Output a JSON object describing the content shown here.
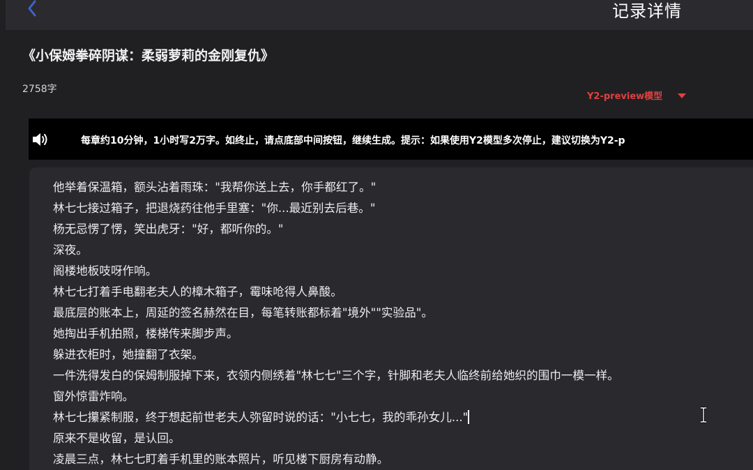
{
  "header": {
    "title": "记录详情",
    "back_icon": "chevron-left-icon"
  },
  "book": {
    "title": "《小保姆拳碎阴谋：柔弱萝莉的金刚复仇》",
    "word_count": "2758字"
  },
  "model_selector": {
    "selected": "Y2-preview模型",
    "icon": "caret-down-icon"
  },
  "notice": {
    "icon": "speaker-icon",
    "text": "每章约10分钟，1小时写2万字。如终止，请点底部中间按钮，继续生成。提示：如果使用Y2模型多次停止，建议切换为Y2-p"
  },
  "content": {
    "lines": [
      "他举着保温箱，额头沾着雨珠：\"我帮你送上去，你手都红了。\"",
      "林七七接过箱子，把退烧药往他手里塞：\"你...最近别去后巷。\"",
      "杨无忌愣了愣，笑出虎牙：\"好，都听你的。\"",
      "深夜。",
      "阁楼地板吱呀作响。",
      "林七七打着手电翻老夫人的樟木箱子，霉味呛得人鼻酸。",
      "最底层的账本上，周延的签名赫然在目，每笔转账都标着\"境外\"\"实验品\"。",
      "她掏出手机拍照，楼梯传来脚步声。",
      "躲进衣柜时，她撞翻了衣架。",
      "一件洗得发白的保姆制服掉下来，衣领内侧绣着\"林七七\"三个字，针脚和老夫人临终前给她织的围巾一模一样。",
      "窗外惊雷炸响。",
      "林七七攥紧制服，终于想起前世老夫人弥留时说的话：\"小七七，我的乖孙女儿...\"",
      "原来不是收留，是认回。",
      "凌晨三点，林七七盯着手机里的账本照片，听见楼下厨房有动静。"
    ]
  },
  "colors": {
    "background": "#202023",
    "header_bg": "#2b2b2f",
    "content_bg": "#2a2a2e",
    "notice_bg": "#000000",
    "accent_red": "#e0413f",
    "back_icon": "#3f63c9"
  }
}
